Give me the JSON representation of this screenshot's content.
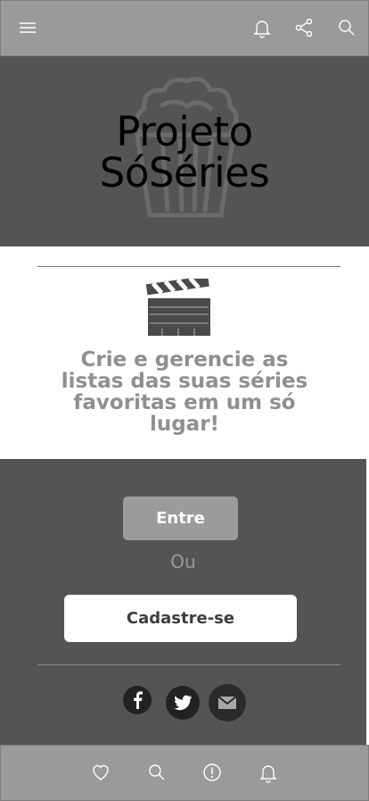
{
  "hero": {
    "title_line1": "Projeto",
    "title_line2": "SóSéries"
  },
  "tagline": "Crie e gerencie as listas das suas séries favoritas em um só lugar!",
  "auth": {
    "login_label": "Entre",
    "or_label": "Ou",
    "signup_label": "Cadastre-se"
  },
  "top_bar": {
    "icons": [
      "menu-icon",
      "bell-icon",
      "share-icon",
      "search-icon"
    ]
  },
  "social": {
    "icons": [
      "facebook-icon",
      "twitter-icon",
      "email-icon"
    ]
  },
  "bottom_nav": {
    "icons": [
      "heart-icon",
      "search-icon",
      "alert-icon",
      "bell-icon"
    ]
  },
  "colors": {
    "bar_gray": "#9a9a9a",
    "panel_dark": "#545454",
    "tagline_gray": "#8f8f8f"
  }
}
